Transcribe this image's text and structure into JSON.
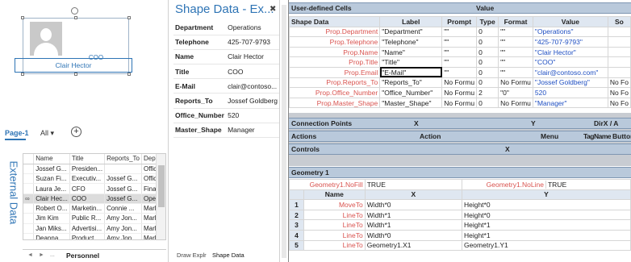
{
  "canvas": {
    "shape_title": "COO",
    "shape_name": "Clair Hector"
  },
  "page_tabs": {
    "active": "Page-1",
    "all": "All",
    "dropdown": "▾",
    "add": "+"
  },
  "external_data": {
    "label": "External Data",
    "columns": [
      "Name",
      "Title",
      "Reports_To",
      "Depar"
    ],
    "rows": [
      [
        "Jossef G...",
        "Presiden...",
        "",
        "Office"
      ],
      [
        "Suzan Fi...",
        "Executiv...",
        "Jossef G...",
        "Office"
      ],
      [
        "Laura Je...",
        "CFO",
        "Jossef G...",
        "Financ"
      ],
      [
        "Clair Hec...",
        "COO",
        "Jossef G...",
        "Opera"
      ],
      [
        "Robert O...",
        "Marketin...",
        "Connie ...",
        "Marke"
      ],
      [
        "Jim Kim",
        "Public R...",
        "Amy Jon...",
        "Marke"
      ],
      [
        "Jan Miks...",
        "Advertisi...",
        "Amy Jon...",
        "Marke"
      ],
      [
        "Deanna ...",
        "Product",
        "Amy Jon...",
        "Marke"
      ]
    ],
    "tab": "Personnel",
    "nav": [
      "◄",
      "►",
      "..."
    ]
  },
  "shape_data": {
    "title": "Shape Data - Ex...",
    "close": "✖",
    "rows": [
      {
        "key": "Department",
        "value": "Operations"
      },
      {
        "key": "Telephone",
        "value": "425-707-9793"
      },
      {
        "key": "Name",
        "value": "Clair Hector"
      },
      {
        "key": "Title",
        "value": "COO"
      },
      {
        "key": "E-Mail",
        "value": "clair@contoso..."
      },
      {
        "key": "Reports_To",
        "value": "Jossef Goldberg"
      },
      {
        "key": "Office_Number",
        "value": "520"
      },
      {
        "key": "Master_Shape",
        "value": "Manager"
      }
    ],
    "tabs": [
      "Draw Explr",
      "Shape Data"
    ]
  },
  "shapesheet": {
    "user_defined": {
      "title": "User-defined Cells",
      "value_col": "Value"
    },
    "shape_data_section": {
      "title": "Shape Data",
      "columns": [
        "Label",
        "Prompt",
        "Type",
        "Format",
        "Value",
        "So"
      ],
      "rows": [
        {
          "name": "Prop.Department",
          "label": "\"Department\"",
          "prompt": "\"\"",
          "type": "0",
          "format": "\"\"",
          "value": "\"Operations\""
        },
        {
          "name": "Prop.Telephone",
          "label": "\"Telephone\"",
          "prompt": "\"\"",
          "type": "0",
          "format": "\"\"",
          "value": "\"425-707-9793\""
        },
        {
          "name": "Prop.Name",
          "label": "\"Name\"",
          "prompt": "\"\"",
          "type": "0",
          "format": "\"\"",
          "value": "\"Clair Hector\""
        },
        {
          "name": "Prop.Title",
          "label": "\"Title\"",
          "prompt": "\"\"",
          "type": "0",
          "format": "\"\"",
          "value": "\"COO\""
        },
        {
          "name": "Prop.Email",
          "label": "\"E-Mail\"",
          "prompt": "\"\"",
          "type": "0",
          "format": "\"\"",
          "value": "\"clair@contoso.com\""
        },
        {
          "name": "Prop.Reports_To",
          "label": "\"Reports_To\"",
          "prompt": "No Formu",
          "type": "0",
          "format": "No Formu",
          "value": "\"Jossef Goldberg\"",
          "so": "No Fo"
        },
        {
          "name": "Prop.Office_Number",
          "label": "\"Office_Number\"",
          "prompt": "No Formu",
          "type": "2",
          "format": "\"0\"",
          "value": "520",
          "so": "No Fo"
        },
        {
          "name": "Prop.Master_Shape",
          "label": "\"Master_Shape\"",
          "prompt": "No Formu",
          "type": "0",
          "format": "No Formu",
          "value": "\"Manager\"",
          "so": "No Fo"
        }
      ]
    },
    "connection_points": {
      "title": "Connection Points",
      "cols": [
        "X",
        "Y",
        "DirX / A"
      ]
    },
    "actions": {
      "title": "Actions",
      "cols": [
        "Action",
        "Menu",
        "TagName",
        "ButtonFace"
      ]
    },
    "controls": {
      "title": "Controls",
      "cols": [
        "X"
      ]
    },
    "geometry": {
      "title": "Geometry 1",
      "nofill_name": "Geometry1.NoFill",
      "nofill_value": "TRUE",
      "noline_name": "Geometry1.NoLine",
      "noline_value": "TRUE",
      "columns": [
        "Name",
        "X",
        "Y"
      ],
      "rows": [
        {
          "n": "1",
          "name": "MoveTo",
          "x": "Width*0",
          "y": "Height*0"
        },
        {
          "n": "2",
          "name": "LineTo",
          "x": "Width*1",
          "y": "Height*0"
        },
        {
          "n": "3",
          "name": "LineTo",
          "x": "Width*1",
          "y": "Height*1"
        },
        {
          "n": "4",
          "name": "LineTo",
          "x": "Width*0",
          "y": "Height*1"
        },
        {
          "n": "5",
          "name": "LineTo",
          "x": "Geometry1.X1",
          "y": "Geometry1.Y1"
        }
      ]
    }
  }
}
